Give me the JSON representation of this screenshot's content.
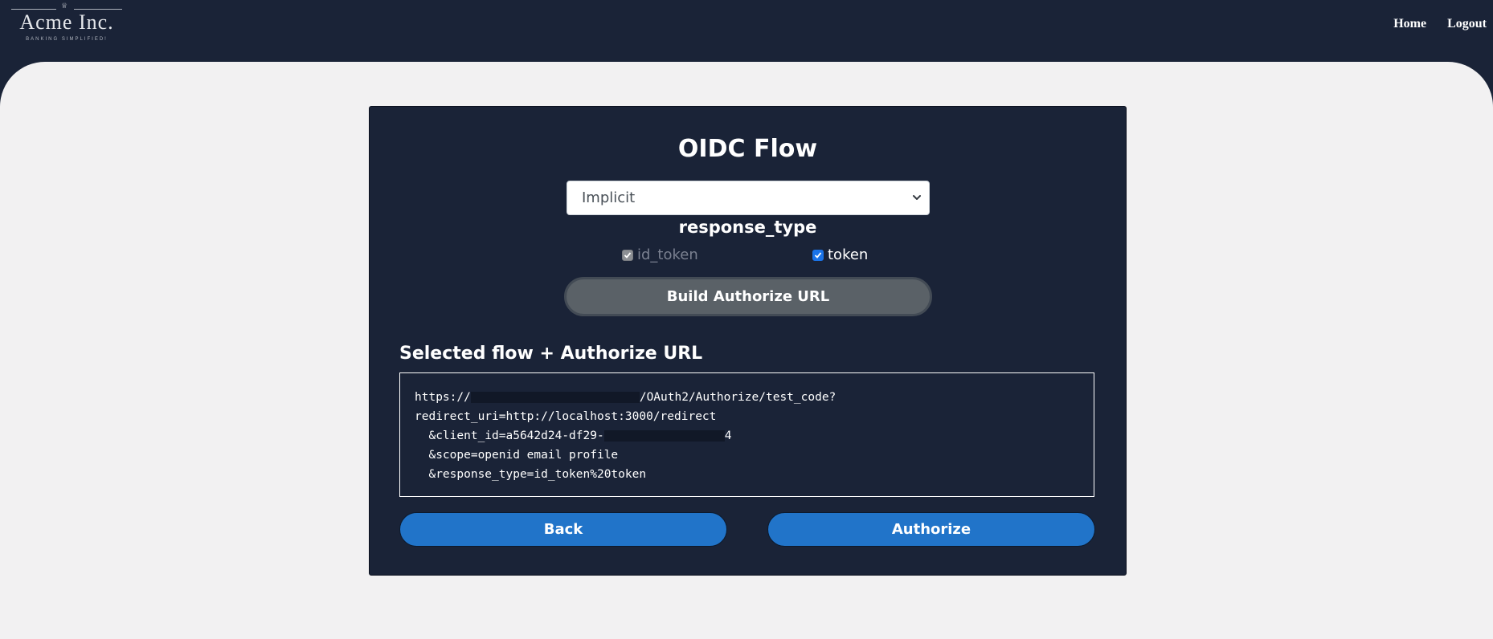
{
  "brand": {
    "name": "Acme Inc.",
    "tagline": "BANKING SIMPLIFIED!"
  },
  "nav": {
    "home": "Home",
    "logout": "Logout"
  },
  "card": {
    "title": "OIDC Flow",
    "flow_select": {
      "selected": "Implicit"
    },
    "response_type_label": "response_type",
    "response_types": [
      {
        "label": "id_token",
        "checked": true,
        "disabled": true
      },
      {
        "label": "token",
        "checked": true,
        "disabled": false
      }
    ],
    "build_button": "Build Authorize URL",
    "section_title": "Selected flow + Authorize URL",
    "url": {
      "line1_prefix": "https://",
      "line1_suffix": "/OAuth2/Authorize/test_code?",
      "line2": "redirect_uri=http://localhost:3000/redirect",
      "line3_prefix": "  &client_id=a5642d24-df29-",
      "line3_suffix": "4",
      "line4": "  &scope=openid email profile",
      "line5": "  &response_type=id_token%20token"
    },
    "back_button": "Back",
    "authorize_button": "Authorize"
  },
  "colors": {
    "navy": "#1a2337",
    "page_bg": "#f2f1f2",
    "primary_blue": "#2174c9",
    "build_gray": "#5a6167"
  }
}
